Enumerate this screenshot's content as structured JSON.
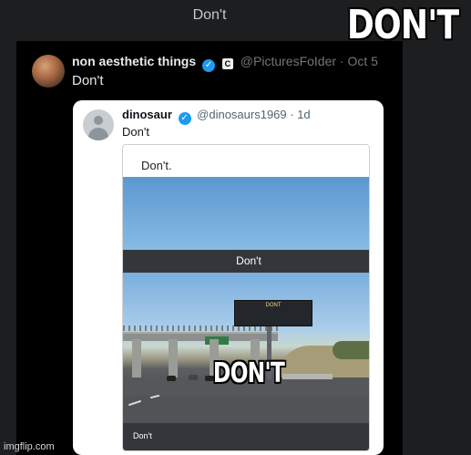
{
  "page_title": "Don't",
  "meme_caption": "DON'T",
  "outer_tweet": {
    "display_name": "non aesthetic things",
    "verified_mark": "✓",
    "affiliate_badge": "C",
    "handle_date": "@PicturesFoIder · Oct 5",
    "text": "Don't"
  },
  "quoted_tweet": {
    "display_name": "dinosaur",
    "verified_mark": "✓",
    "handle_date": "@dinosaurs1969 · 1d",
    "text": "Don't",
    "inner_card_text": "Don't.",
    "banner_top_text": "Don't",
    "billboard_text": "DONT",
    "overlay_text": "DON'T",
    "banner_bottom_text": "Don't"
  },
  "watermark": "imgflip.com",
  "colors": {
    "background": "#1d1e20",
    "tweet_bg": "#000000",
    "verified_blue": "#1d9bf0",
    "card_bg": "#ffffff"
  }
}
